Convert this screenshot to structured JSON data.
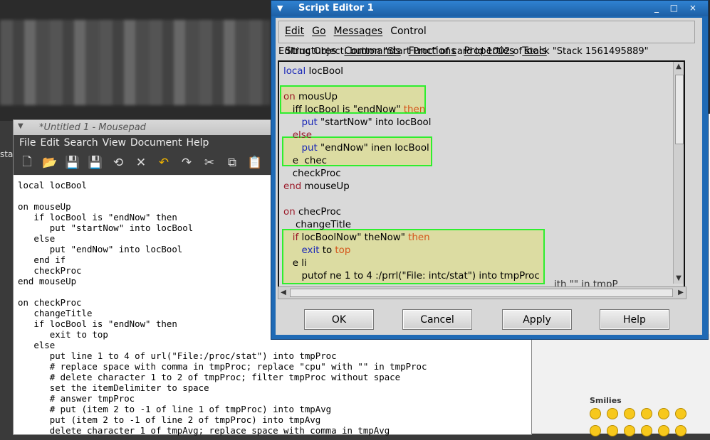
{
  "background": {
    "stats_fragment": "sta",
    "edge_fragment": "e",
    "smilies_title": "Smilies",
    "smiley_count": 12
  },
  "mousepad": {
    "title": "*Untitled 1 - Mousepad",
    "menu": [
      "File",
      "Edit",
      "Search",
      "View",
      "Document",
      "Help"
    ],
    "toolbar_icons": [
      "new-document-icon",
      "open-icon",
      "save-icon",
      "save-as-icon",
      "revert-icon",
      "close-icon",
      "undo-icon",
      "redo-icon",
      "cut-icon",
      "copy-icon",
      "paste-icon"
    ],
    "text": "local locBool\n\non mouseUp\n   if locBool is \"endNow\" then\n      put \"startNow\" into locBool\n   else\n      put \"endNow\" into locBool\n   end if\n   checkProc\nend mouseUp\n\non checkProc\n   changeTitle\n   if locBool is \"endNow\" then\n      exit to top\n   else\n      put line 1 to 4 of url(\"File:/proc/stat\") into tmpProc\n      # replace space with comma in tmpProc; replace \"cpu\" with \"\" in tmpProc\n      # delete character 1 to 2 of tmpProc; filter tmpProc without space\n      set the itemDelimiter to space\n      # answer tmpProc\n      # put (item 2 to -1 of line 1 of tmpProc) into tmpAvg\n      put (item 2 to -1 of line 2 of tmpProc) into tmpAvg\n      delete character 1 of tmpAvg; replace space with comma in tmpAvg"
  },
  "script_editor": {
    "title": "Script Editor 1",
    "window_buttons": "_ □ ×",
    "menu": [
      {
        "label": "Edit",
        "underline": true
      },
      {
        "label": "Go",
        "underline": true
      },
      {
        "label": "Messages",
        "underline": true
      },
      {
        "label": "Control Structures",
        "underline": false
      },
      {
        "label": "Commands",
        "underline": true
      },
      {
        "label": "Functions",
        "underline": true
      },
      {
        "label": "Properties",
        "underline": true
      },
      {
        "label": "Tools",
        "underline": true
      }
    ],
    "editing_object": "Editing Object: button \"Start Proc\" of card id 1002 of stack \"Stack 1561495889\"",
    "code_lines": [
      [
        {
          "t": "local",
          "c": "blue"
        },
        {
          "t": " locBool"
        }
      ],
      [],
      [
        {
          "t": "on",
          "c": "red"
        },
        {
          "t": " mousUp"
        }
      ],
      [
        {
          "t": "   iff locBool is \"endNow\" "
        },
        {
          "t": "then",
          "c": "orange"
        }
      ],
      [
        {
          "t": "      "
        },
        {
          "t": "put",
          "c": "blue"
        },
        {
          "t": " \"startNow\" into locBool"
        }
      ],
      [
        {
          "t": "   "
        },
        {
          "t": "else",
          "c": "red"
        }
      ],
      [
        {
          "t": "      "
        },
        {
          "t": "put",
          "c": "blue"
        },
        {
          "t": " \"endNow\" inen locBool"
        }
      ],
      [
        {
          "t": "   e  chec"
        }
      ],
      [
        {
          "t": "   checkProc"
        }
      ],
      [
        {
          "t": "end",
          "c": "red"
        },
        {
          "t": " mouseUp"
        }
      ],
      [],
      [
        {
          "t": "on",
          "c": "red"
        },
        {
          "t": " checProc"
        }
      ],
      [
        {
          "t": "    changeTitle"
        }
      ],
      [
        {
          "t": "   "
        },
        {
          "t": "if",
          "c": "red"
        },
        {
          "t": " locBoolNow\" theNow\" "
        },
        {
          "t": "then",
          "c": "orange"
        }
      ],
      [
        {
          "t": "      "
        },
        {
          "t": "exit",
          "c": "blue"
        },
        {
          "t": " to "
        },
        {
          "t": "top",
          "c": "orange"
        }
      ],
      [
        {
          "t": "   e li"
        }
      ],
      [
        {
          "t": "      putof ne 1 to 4 :/prrl(\"File: intc/stat\") into tmpProc"
        }
      ]
    ],
    "code_overflow_fragment": "ith \"\" in tmpP",
    "buttons": {
      "ok": "OK",
      "cancel": "Cancel",
      "apply": "Apply",
      "help": "Help"
    },
    "highlight_color": "#2fee2f"
  }
}
